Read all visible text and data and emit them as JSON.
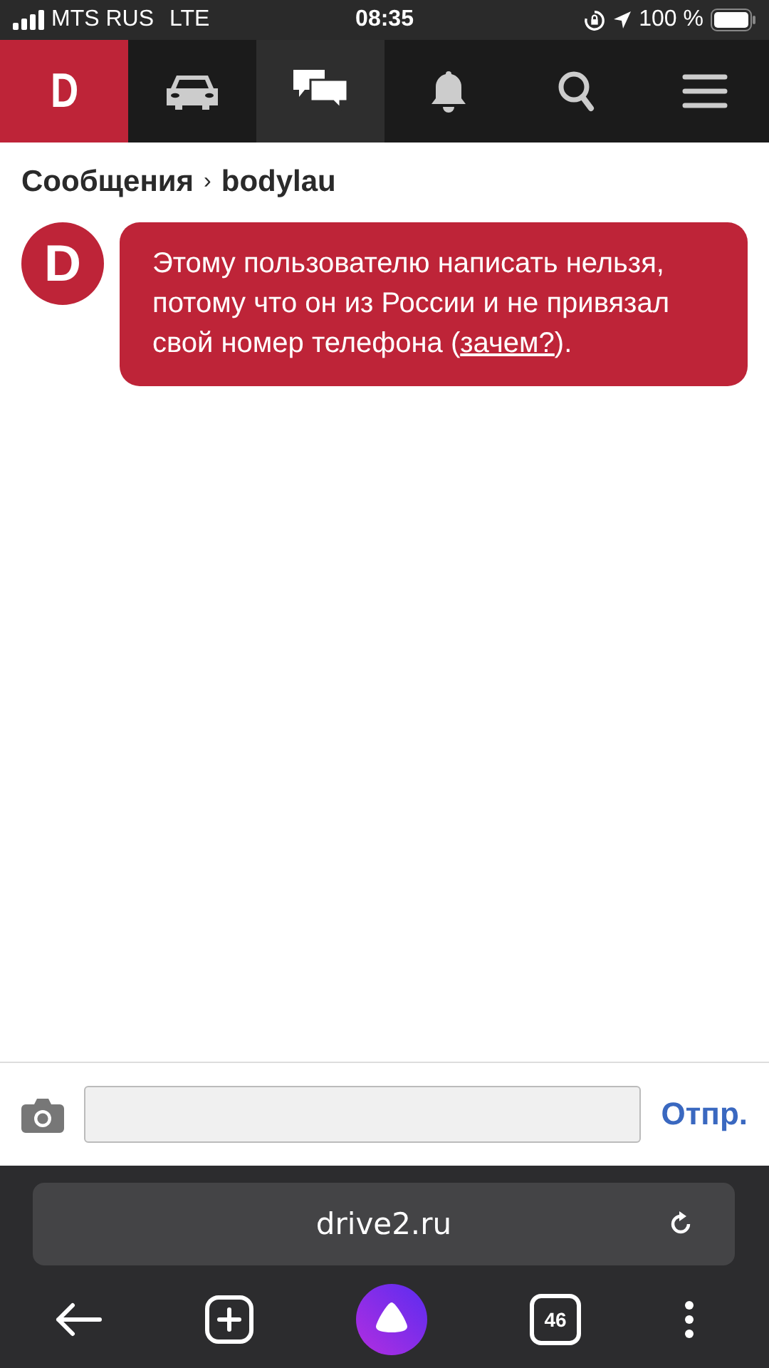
{
  "status_bar": {
    "carrier": "MTS RUS",
    "network": "LTE",
    "time": "08:35",
    "battery": "100 %"
  },
  "nav": {
    "tabs": [
      {
        "kind": "logo",
        "label": "D"
      },
      {
        "kind": "car",
        "selected": false
      },
      {
        "kind": "chat",
        "selected": true
      },
      {
        "kind": "bell",
        "selected": false
      },
      {
        "kind": "search",
        "selected": false
      },
      {
        "kind": "menu",
        "selected": false
      }
    ]
  },
  "breadcrumb": {
    "parent": "Сообщения",
    "separator": "›",
    "current": "bodylau"
  },
  "message": {
    "avatar": "D",
    "text_before": "Этому пользователю написать нельзя, потому что он из России и не привязал свой номер телефона (",
    "link": "зачем?",
    "text_after": ")."
  },
  "composer": {
    "send": "Отпр."
  },
  "browser": {
    "url": "drive2.ru",
    "tabs_count": "46"
  }
}
